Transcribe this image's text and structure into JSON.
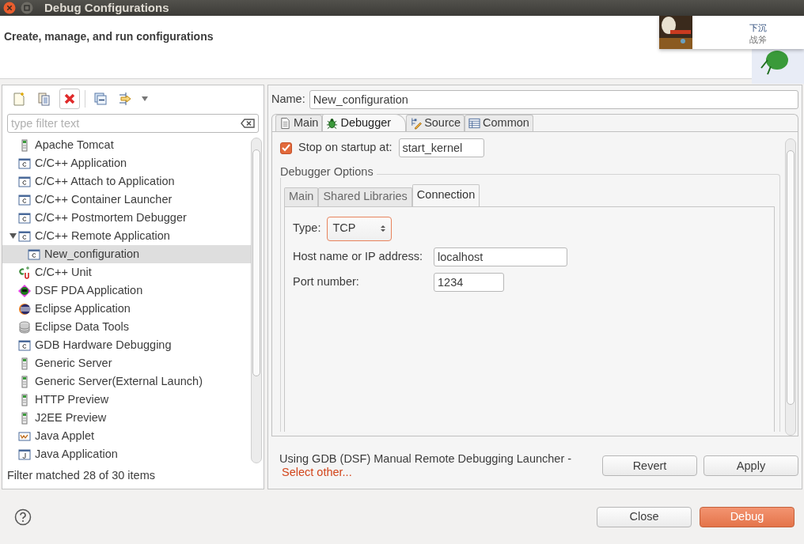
{
  "window": {
    "title": "Debug Configurations"
  },
  "header": {
    "title": "Create, manage, and run configurations"
  },
  "popup": {
    "title": "下沉",
    "subtitle": "战斧"
  },
  "filter": {
    "placeholder": "type filter text"
  },
  "tree": [
    {
      "label": "Apache Tomcat",
      "kind": "server",
      "selected": false
    },
    {
      "label": "C/C++ Application",
      "kind": "c",
      "selected": false
    },
    {
      "label": "C/C++ Attach to Application",
      "kind": "c",
      "selected": false
    },
    {
      "label": "C/C++ Container Launcher",
      "kind": "c",
      "selected": false
    },
    {
      "label": "C/C++ Postmortem Debugger",
      "kind": "c",
      "selected": false
    },
    {
      "label": "C/C++ Remote Application",
      "kind": "c",
      "selected": false,
      "expanded": true,
      "children": [
        {
          "label": "New_configuration",
          "kind": "c",
          "selected": true
        }
      ]
    },
    {
      "label": "C/C++ Unit",
      "kind": "cunit",
      "selected": false
    },
    {
      "label": "DSF PDA Application",
      "kind": "dsf",
      "selected": false
    },
    {
      "label": "Eclipse Application",
      "kind": "eclipse",
      "selected": false
    },
    {
      "label": "Eclipse Data Tools",
      "kind": "database",
      "selected": false
    },
    {
      "label": "GDB Hardware Debugging",
      "kind": "c",
      "selected": false
    },
    {
      "label": "Generic Server",
      "kind": "server",
      "selected": false
    },
    {
      "label": "Generic Server(External Launch)",
      "kind": "server",
      "selected": false
    },
    {
      "label": "HTTP Preview",
      "kind": "server",
      "selected": false
    },
    {
      "label": "J2EE Preview",
      "kind": "server",
      "selected": false
    },
    {
      "label": "Java Applet",
      "kind": "applet",
      "selected": false
    },
    {
      "label": "Java Application",
      "kind": "java",
      "selected": false
    }
  ],
  "filter_status": "Filter matched 28 of 30 items",
  "name_field": {
    "label": "Name:",
    "value": "New_configuration"
  },
  "tabs": [
    {
      "label": "Main",
      "kind": "page",
      "selected": false
    },
    {
      "label": "Debugger",
      "kind": "bug",
      "selected": true
    },
    {
      "label": "Source",
      "kind": "source",
      "selected": false
    },
    {
      "label": "Common",
      "kind": "table",
      "selected": false
    }
  ],
  "stop_on_startup": {
    "label": "Stop on startup at:",
    "checked": true,
    "value": "start_kernel"
  },
  "debugger_options": {
    "title": "Debugger Options",
    "tabs": [
      {
        "label": "Main",
        "selected": false
      },
      {
        "label": "Shared Libraries",
        "selected": false
      },
      {
        "label": "Connection",
        "selected": true
      }
    ],
    "type": {
      "label": "Type:",
      "value": "TCP"
    },
    "host": {
      "label": "Host name or IP address:",
      "value": "localhost"
    },
    "port": {
      "label": "Port number:",
      "value": "1234"
    }
  },
  "launcher": {
    "text": "Using GDB (DSF) Manual Remote Debugging Launcher -",
    "link": "Select other..."
  },
  "panel_buttons": [
    "Revert",
    "Apply"
  ],
  "dialog_buttons": [
    {
      "label": "Close",
      "kind": "default"
    },
    {
      "label": "Debug",
      "kind": "primary"
    }
  ]
}
